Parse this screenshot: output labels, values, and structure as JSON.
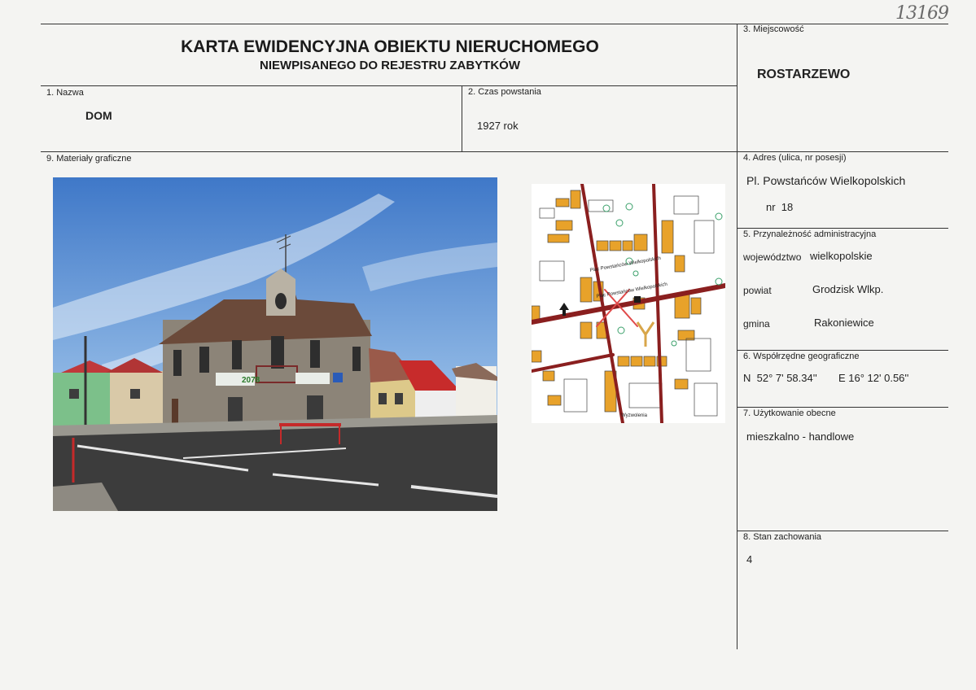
{
  "header": {
    "handwritten_number": "13169",
    "title": "KARTA EWIDENCYJNA OBIEKTU NIERUCHOMEGO",
    "subtitle": "NIEWPISANEGO DO REJESTRU ZABYTKÓW"
  },
  "fields": {
    "name": {
      "label": "1. Nazwa",
      "value": "DOM"
    },
    "created": {
      "label": "2. Czas powstania",
      "value": "1927 rok"
    },
    "locality": {
      "label": "3. Miejscowość",
      "value": "ROSTARZEWO"
    },
    "address": {
      "label": "4. Adres (ulica, nr posesji)",
      "street": "Pl. Powstańców Wielkopolskich",
      "number": "nr  18"
    },
    "admin": {
      "label": "5. Przynależność administracyjna",
      "voivodeship_label": "województwo",
      "voivodeship_value": "wielkopolskie",
      "county_label": "powiat",
      "county_value": "Grodzisk Wlkp.",
      "commune_label": "gmina",
      "commune_value": "Rakoniewice"
    },
    "coords": {
      "label": "6. Współrzędne geograficzne",
      "north": "N  52° 7' 58.34''",
      "east": "E 16° 12' 0.56''"
    },
    "usage": {
      "label": "7. Użytkowanie obecne",
      "value": "mieszkalno - handlowe"
    },
    "condition": {
      "label": "8. Stan zachowania",
      "value": "4"
    },
    "graphics": {
      "label": "9. Materiały graficzne"
    }
  },
  "photo": {
    "shop_sign": "2078"
  },
  "map": {
    "street_labels": [
      "Plac Powstańców Wielkopolskich",
      "Plac Powstańców Wielkopolskich",
      "Wyzwolenia"
    ]
  }
}
